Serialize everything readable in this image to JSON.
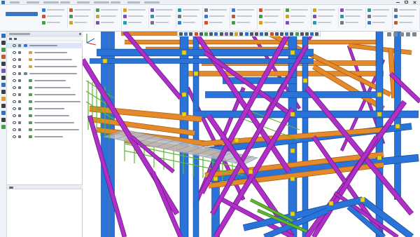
{
  "window": {
    "title": "",
    "menu_count": 9
  },
  "ribbon": {
    "active_document_tab": "",
    "group_count": 14
  },
  "left_panel": {
    "title": "",
    "bottom_section_label": "",
    "tree_items": [
      {
        "label": "",
        "indent": 0,
        "icon": "model-icon",
        "color": "#3c72c2"
      },
      {
        "label": "",
        "indent": 1,
        "icon": "folder-icon",
        "color": "#d9a33a"
      },
      {
        "label": "",
        "indent": 1,
        "icon": "folder-icon",
        "color": "#d9a33a"
      },
      {
        "label": "",
        "indent": 1,
        "icon": "folder-icon",
        "color": "#d9a33a"
      },
      {
        "label": "",
        "indent": 0,
        "icon": "layers-icon",
        "color": "#6c7f96"
      },
      {
        "label": "",
        "indent": 1,
        "icon": "layer-icon",
        "color": "#4f9a54"
      },
      {
        "label": "",
        "indent": 1,
        "icon": "layer-icon",
        "color": "#4f9a54"
      },
      {
        "label": "",
        "indent": 1,
        "icon": "layer-icon",
        "color": "#4f9a54"
      },
      {
        "label": "",
        "indent": 1,
        "icon": "layer-icon",
        "color": "#4f9a54"
      },
      {
        "label": "",
        "indent": 1,
        "icon": "layer-icon",
        "color": "#4f9a54"
      },
      {
        "label": "",
        "indent": 1,
        "icon": "layer-icon",
        "color": "#4f9a54"
      },
      {
        "label": "",
        "indent": 1,
        "icon": "layer-icon",
        "color": "#4f9a54"
      },
      {
        "label": "",
        "indent": 1,
        "icon": "layer-icon",
        "color": "#4f9a54"
      },
      {
        "label": "",
        "indent": 1,
        "icon": "layer-icon",
        "color": "#4f9a54"
      }
    ]
  },
  "viewport": {
    "axis_labels": {
      "x": "",
      "y": "",
      "z": ""
    },
    "colors": {
      "column_blue": "#2a73d8",
      "column_blue_dark": "#174f9e",
      "beam_orange": "#e48a2a",
      "beam_orange_dark": "#a95d15",
      "brace_magenta": "#b02fc9",
      "railing_green": "#5fb830",
      "connection_yellow": "#e8d21a",
      "grating_grey": "#8f969e"
    }
  },
  "accent_colors": {
    "primary": "#3b75c4",
    "selection": "#dbe7f7",
    "toolbar_bg": "#f6f8fb"
  }
}
